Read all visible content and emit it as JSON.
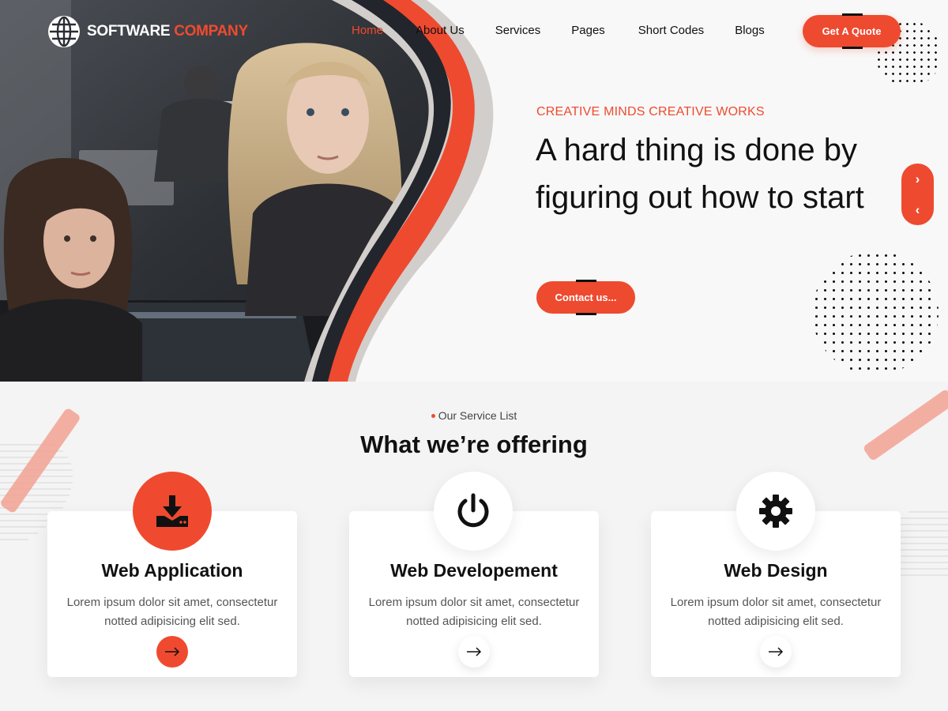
{
  "brand": {
    "name_part1": "SOFTWARE",
    "name_part2": "COMPANY"
  },
  "nav": {
    "items": [
      {
        "label": "Home",
        "active": true
      },
      {
        "label": "About Us",
        "active": false
      },
      {
        "label": "Services",
        "active": false
      },
      {
        "label": "Pages",
        "active": false
      },
      {
        "label": "Short Codes",
        "active": false
      },
      {
        "label": "Blogs",
        "active": false
      }
    ],
    "cta_label": "Get A Quote"
  },
  "hero": {
    "kicker": "CREATIVE MINDS CREATIVE WORKS",
    "headline": "A hard thing is done by figuring out how to start",
    "cta_label": "Contact us...",
    "slider_next_icon": "chevron-right-icon",
    "slider_prev_icon": "chevron-left-icon"
  },
  "services": {
    "kicker": "Our Service List",
    "title": "What we’re offering",
    "cards": [
      {
        "title": "Web Application",
        "text": "Lorem ipsum dolor sit amet, consectetur notted adipisicing elit sed.",
        "icon": "download-icon",
        "highlighted": true
      },
      {
        "title": "Web Developement",
        "text": "Lorem ipsum dolor sit amet, consectetur notted adipisicing elit sed.",
        "icon": "power-icon",
        "highlighted": false
      },
      {
        "title": "Web Design",
        "text": "Lorem ipsum dolor sit amet, consectetur notted adipisicing elit sed.",
        "icon": "gear-icon",
        "highlighted": false
      }
    ]
  },
  "colors": {
    "accent": "#ef4a2f",
    "text": "#111111",
    "muted": "#555555",
    "background": "#f4f4f4"
  }
}
